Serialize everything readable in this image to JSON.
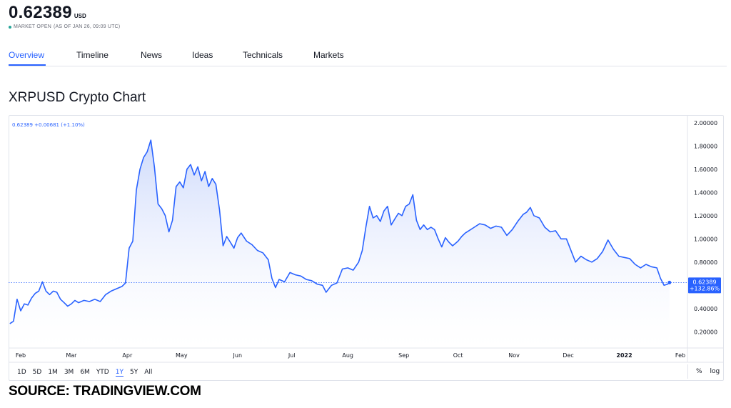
{
  "header": {
    "price": "0.62389",
    "currency": "USD",
    "market_status": "MARKET OPEN",
    "as_of": "(AS OF JAN 26, 09:09 UTC)"
  },
  "tabs": [
    {
      "label": "Overview",
      "active": true
    },
    {
      "label": "Timeline",
      "active": false
    },
    {
      "label": "News",
      "active": false
    },
    {
      "label": "Ideas",
      "active": false
    },
    {
      "label": "Technicals",
      "active": false
    },
    {
      "label": "Markets",
      "active": false
    }
  ],
  "chart_heading": "XRPUSD Crypto Chart",
  "legend": "0.62389  +0.00681 (+1.10%)",
  "last_price_label": "0.62389",
  "last_change_label": "+132.86%",
  "range_buttons": [
    {
      "label": "1D",
      "active": false
    },
    {
      "label": "5D",
      "active": false
    },
    {
      "label": "1M",
      "active": false
    },
    {
      "label": "3M",
      "active": false
    },
    {
      "label": "6M",
      "active": false
    },
    {
      "label": "YTD",
      "active": false
    },
    {
      "label": "1Y",
      "active": true
    },
    {
      "label": "5Y",
      "active": false
    },
    {
      "label": "All",
      "active": false
    }
  ],
  "scale_buttons": [
    "%",
    "log"
  ],
  "source_note": "SOURCE: TRADINGVIEW.COM",
  "colors": {
    "accent": "#2962ff",
    "line": "#2962ff",
    "fill_top": "#c9d6fb",
    "status_green": "#26a69a"
  },
  "chart_data": {
    "type": "area",
    "title": "XRPUSD Crypto Chart",
    "xlabel": "",
    "ylabel": "",
    "x_tick_labels": [
      "Feb",
      "Mar",
      "Apr",
      "May",
      "Jun",
      "Jul",
      "Aug",
      "Sep",
      "Oct",
      "Nov",
      "Dec",
      "2022",
      "Feb"
    ],
    "y_tick_labels": [
      "2.00000",
      "1.80000",
      "1.60000",
      "1.40000",
      "1.20000",
      "1.00000",
      "0.80000",
      "0.60000",
      "0.40000",
      "0.20000"
    ],
    "y_ticks": [
      2.0,
      1.8,
      1.6,
      1.4,
      1.2,
      1.0,
      0.8,
      0.6,
      0.4,
      0.2
    ],
    "ylim": [
      0.06,
      2.06
    ],
    "grid": false,
    "reference_line": 0.62389,
    "series": [
      {
        "name": "",
        "points": [
          [
            "2021-01-26",
            0.27
          ],
          [
            "2021-01-28",
            0.29
          ],
          [
            "2021-01-30",
            0.48
          ],
          [
            "2021-02-01",
            0.38
          ],
          [
            "2021-02-03",
            0.44
          ],
          [
            "2021-02-05",
            0.43
          ],
          [
            "2021-02-07",
            0.49
          ],
          [
            "2021-02-09",
            0.53
          ],
          [
            "2021-02-11",
            0.55
          ],
          [
            "2021-02-13",
            0.63
          ],
          [
            "2021-02-15",
            0.55
          ],
          [
            "2021-02-17",
            0.52
          ],
          [
            "2021-02-19",
            0.55
          ],
          [
            "2021-02-21",
            0.54
          ],
          [
            "2021-02-23",
            0.48
          ],
          [
            "2021-02-25",
            0.45
          ],
          [
            "2021-02-27",
            0.42
          ],
          [
            "2021-03-01",
            0.44
          ],
          [
            "2021-03-03",
            0.47
          ],
          [
            "2021-03-05",
            0.45
          ],
          [
            "2021-03-08",
            0.47
          ],
          [
            "2021-03-11",
            0.46
          ],
          [
            "2021-03-14",
            0.48
          ],
          [
            "2021-03-17",
            0.46
          ],
          [
            "2021-03-20",
            0.52
          ],
          [
            "2021-03-23",
            0.55
          ],
          [
            "2021-03-26",
            0.57
          ],
          [
            "2021-03-29",
            0.59
          ],
          [
            "2021-03-31",
            0.62
          ],
          [
            "2021-04-02",
            0.92
          ],
          [
            "2021-04-04",
            0.98
          ],
          [
            "2021-04-06",
            1.42
          ],
          [
            "2021-04-08",
            1.6
          ],
          [
            "2021-04-10",
            1.7
          ],
          [
            "2021-04-12",
            1.75
          ],
          [
            "2021-04-14",
            1.85
          ],
          [
            "2021-04-16",
            1.62
          ],
          [
            "2021-04-18",
            1.3
          ],
          [
            "2021-04-20",
            1.26
          ],
          [
            "2021-04-22",
            1.2
          ],
          [
            "2021-04-24",
            1.06
          ],
          [
            "2021-04-26",
            1.16
          ],
          [
            "2021-04-28",
            1.45
          ],
          [
            "2021-04-30",
            1.49
          ],
          [
            "2021-05-02",
            1.44
          ],
          [
            "2021-05-04",
            1.6
          ],
          [
            "2021-05-06",
            1.64
          ],
          [
            "2021-05-08",
            1.55
          ],
          [
            "2021-05-10",
            1.62
          ],
          [
            "2021-05-12",
            1.5
          ],
          [
            "2021-05-14",
            1.58
          ],
          [
            "2021-05-16",
            1.45
          ],
          [
            "2021-05-18",
            1.52
          ],
          [
            "2021-05-20",
            1.47
          ],
          [
            "2021-05-22",
            1.25
          ],
          [
            "2021-05-24",
            0.94
          ],
          [
            "2021-05-26",
            1.02
          ],
          [
            "2021-05-28",
            0.97
          ],
          [
            "2021-05-30",
            0.92
          ],
          [
            "2021-06-01",
            1.01
          ],
          [
            "2021-06-03",
            1.05
          ],
          [
            "2021-06-06",
            0.98
          ],
          [
            "2021-06-09",
            0.95
          ],
          [
            "2021-06-12",
            0.9
          ],
          [
            "2021-06-15",
            0.88
          ],
          [
            "2021-06-18",
            0.82
          ],
          [
            "2021-06-20",
            0.66
          ],
          [
            "2021-06-22",
            0.58
          ],
          [
            "2021-06-24",
            0.65
          ],
          [
            "2021-06-27",
            0.63
          ],
          [
            "2021-06-30",
            0.71
          ],
          [
            "2021-07-03",
            0.69
          ],
          [
            "2021-07-06",
            0.68
          ],
          [
            "2021-07-09",
            0.65
          ],
          [
            "2021-07-12",
            0.64
          ],
          [
            "2021-07-15",
            0.61
          ],
          [
            "2021-07-18",
            0.6
          ],
          [
            "2021-07-20",
            0.54
          ],
          [
            "2021-07-23",
            0.6
          ],
          [
            "2021-07-26",
            0.62
          ],
          [
            "2021-07-29",
            0.74
          ],
          [
            "2021-08-01",
            0.75
          ],
          [
            "2021-08-04",
            0.73
          ],
          [
            "2021-08-07",
            0.8
          ],
          [
            "2021-08-09",
            0.9
          ],
          [
            "2021-08-11",
            1.1
          ],
          [
            "2021-08-13",
            1.28
          ],
          [
            "2021-08-15",
            1.18
          ],
          [
            "2021-08-17",
            1.2
          ],
          [
            "2021-08-19",
            1.15
          ],
          [
            "2021-08-21",
            1.24
          ],
          [
            "2021-08-23",
            1.28
          ],
          [
            "2021-08-25",
            1.12
          ],
          [
            "2021-08-27",
            1.17
          ],
          [
            "2021-08-29",
            1.22
          ],
          [
            "2021-08-31",
            1.2
          ],
          [
            "2021-09-02",
            1.28
          ],
          [
            "2021-09-04",
            1.3
          ],
          [
            "2021-09-06",
            1.38
          ],
          [
            "2021-09-08",
            1.16
          ],
          [
            "2021-09-10",
            1.08
          ],
          [
            "2021-09-12",
            1.12
          ],
          [
            "2021-09-14",
            1.08
          ],
          [
            "2021-09-16",
            1.1
          ],
          [
            "2021-09-18",
            1.08
          ],
          [
            "2021-09-20",
            1.0
          ],
          [
            "2021-09-22",
            0.93
          ],
          [
            "2021-09-24",
            1.01
          ],
          [
            "2021-09-26",
            0.97
          ],
          [
            "2021-09-28",
            0.94
          ],
          [
            "2021-10-01",
            0.98
          ],
          [
            "2021-10-03",
            1.02
          ],
          [
            "2021-10-05",
            1.05
          ],
          [
            "2021-10-07",
            1.07
          ],
          [
            "2021-10-10",
            1.1
          ],
          [
            "2021-10-13",
            1.13
          ],
          [
            "2021-10-16",
            1.12
          ],
          [
            "2021-10-19",
            1.09
          ],
          [
            "2021-10-22",
            1.11
          ],
          [
            "2021-10-25",
            1.1
          ],
          [
            "2021-10-28",
            1.03
          ],
          [
            "2021-10-31",
            1.08
          ],
          [
            "2021-11-03",
            1.15
          ],
          [
            "2021-11-06",
            1.21
          ],
          [
            "2021-11-08",
            1.23
          ],
          [
            "2021-11-10",
            1.27
          ],
          [
            "2021-11-12",
            1.2
          ],
          [
            "2021-11-15",
            1.18
          ],
          [
            "2021-11-18",
            1.1
          ],
          [
            "2021-11-21",
            1.06
          ],
          [
            "2021-11-24",
            1.07
          ],
          [
            "2021-11-27",
            1.0
          ],
          [
            "2021-11-30",
            1.0
          ],
          [
            "2021-12-03",
            0.88
          ],
          [
            "2021-12-05",
            0.8
          ],
          [
            "2021-12-08",
            0.85
          ],
          [
            "2021-12-11",
            0.82
          ],
          [
            "2021-12-14",
            0.8
          ],
          [
            "2021-12-17",
            0.83
          ],
          [
            "2021-12-20",
            0.89
          ],
          [
            "2021-12-23",
            0.99
          ],
          [
            "2021-12-26",
            0.91
          ],
          [
            "2021-12-29",
            0.85
          ],
          [
            "2022-01-01",
            0.84
          ],
          [
            "2022-01-04",
            0.83
          ],
          [
            "2022-01-07",
            0.78
          ],
          [
            "2022-01-10",
            0.75
          ],
          [
            "2022-01-13",
            0.78
          ],
          [
            "2022-01-16",
            0.76
          ],
          [
            "2022-01-19",
            0.75
          ],
          [
            "2022-01-21",
            0.66
          ],
          [
            "2022-01-23",
            0.6
          ],
          [
            "2022-01-25",
            0.61
          ],
          [
            "2022-01-26",
            0.62389
          ]
        ]
      }
    ]
  }
}
